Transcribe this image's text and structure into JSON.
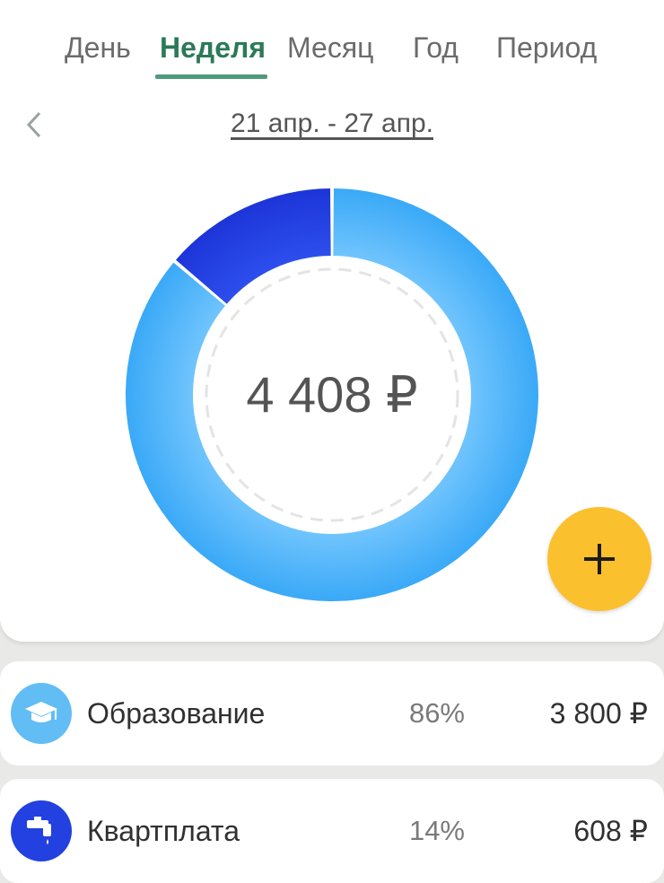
{
  "tabs": [
    {
      "label": "День"
    },
    {
      "label": "Неделя",
      "active": true
    },
    {
      "label": "Месяц"
    },
    {
      "label": "Год"
    },
    {
      "label": "Период"
    }
  ],
  "period": {
    "range": "21 апр. - 27 апр."
  },
  "chart_data": {
    "type": "pie",
    "total": "4 408 ₽",
    "slices": [
      {
        "name": "Образование",
        "value": 3800,
        "percent": 86,
        "color": "#45b0fb"
      },
      {
        "name": "Квартплата",
        "value": 608,
        "percent": 14,
        "color": "#2340e0"
      }
    ]
  },
  "fab": {
    "icon": "plus-icon",
    "color": "#fbc02d"
  },
  "categories": [
    {
      "name": "Образование",
      "percent": "86%",
      "amount": "3 800 ₽",
      "icon": "graduation-cap-icon",
      "color": "#62bdf5"
    },
    {
      "name": "Квартплата",
      "percent": "14%",
      "amount": "608 ₽",
      "icon": "faucet-icon",
      "color": "#2340e0"
    }
  ]
}
